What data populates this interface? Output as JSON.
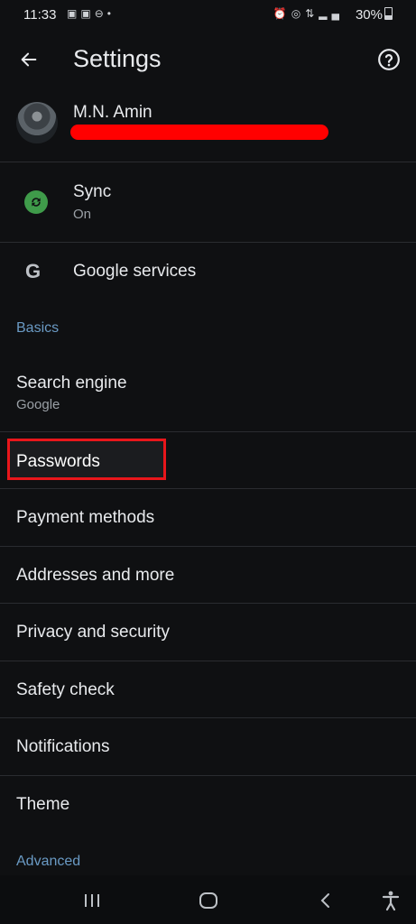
{
  "status_bar": {
    "time": "11:33",
    "left_icons": [
      "calendar-icon",
      "calendar-icon",
      "dnd-icon",
      "dot-icon"
    ],
    "right_icons": [
      "alarm-icon",
      "hotspot-icon",
      "4g-icon",
      "signal-icon"
    ],
    "battery_text": "30%"
  },
  "toolbar": {
    "title": "Settings",
    "back_icon": "arrow-left-icon",
    "help_icon": "help-circle-icon"
  },
  "account": {
    "name": "M.N. Amin"
  },
  "sync": {
    "label": "Sync",
    "status": "On"
  },
  "google_services": {
    "label": "Google services"
  },
  "sections": {
    "basics": "Basics",
    "advanced": "Advanced"
  },
  "search_engine": {
    "label": "Search engine",
    "value": "Google"
  },
  "items": {
    "passwords": "Passwords",
    "payment_methods": "Payment methods",
    "addresses": "Addresses and more",
    "privacy": "Privacy and security",
    "safety_check": "Safety check",
    "notifications": "Notifications",
    "theme": "Theme"
  },
  "colors": {
    "background": "#0f1012",
    "section_header": "#6a9ac4",
    "highlight_border": "#e8161b",
    "sync_green": "#3f9b4a"
  },
  "nav_icons": [
    "recent-apps-icon",
    "home-icon",
    "back-icon",
    "accessibility-icon"
  ]
}
